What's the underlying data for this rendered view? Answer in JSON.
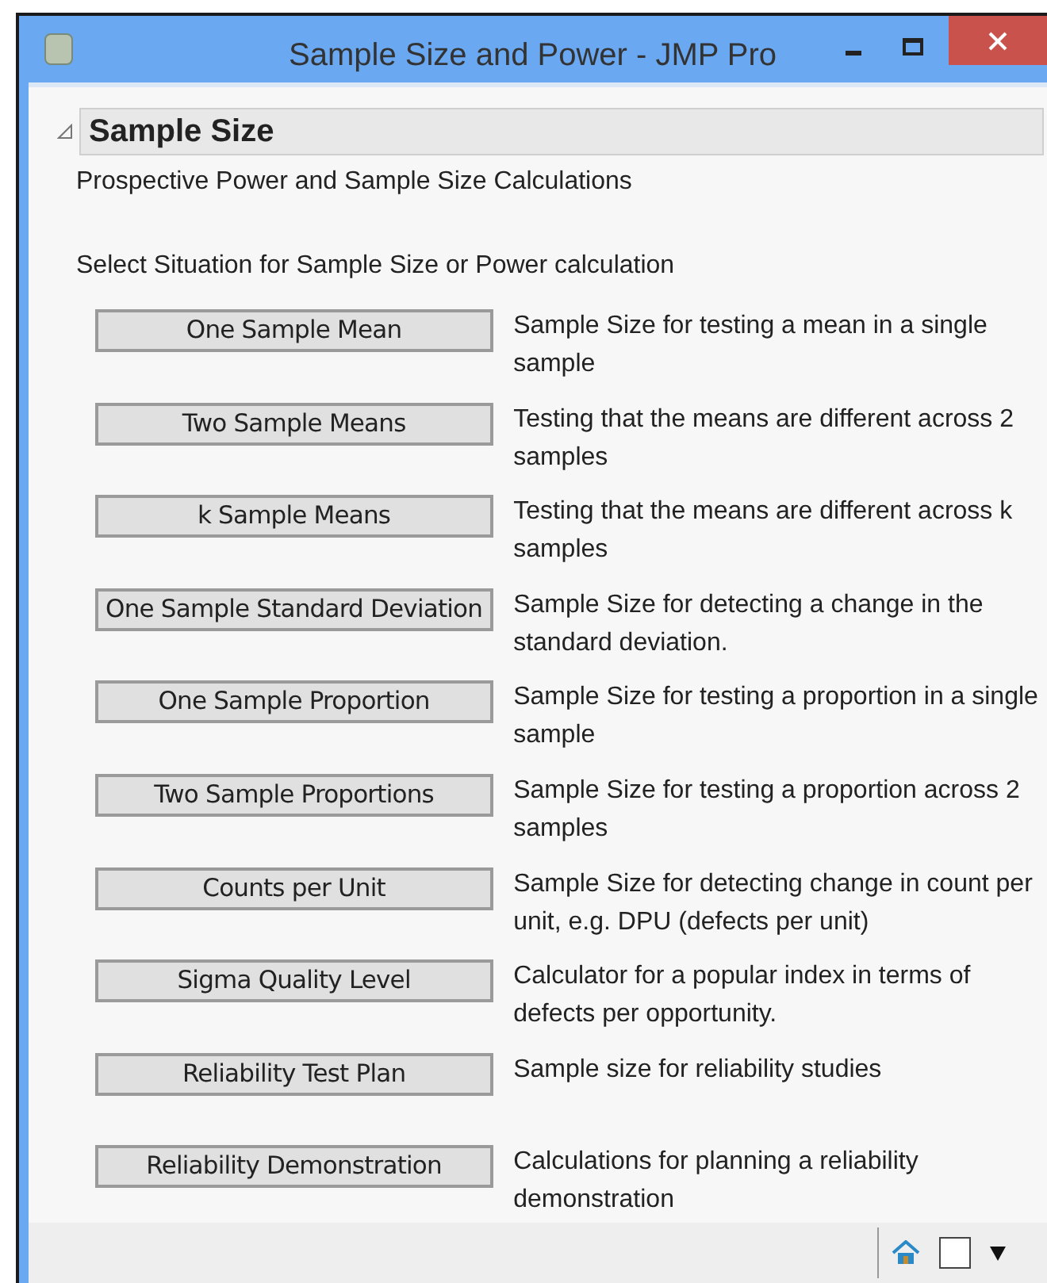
{
  "window": {
    "title": "Sample Size and Power - JMP Pro"
  },
  "section": {
    "title": "Sample Size",
    "expanded": true,
    "subtitle": "Prospective Power and Sample Size Calculations",
    "prompt": "Select Situation for Sample Size or Power calculation"
  },
  "situations": [
    {
      "button": "One Sample Mean",
      "description": "Sample Size for testing a mean in a single sample"
    },
    {
      "button": "Two Sample Means",
      "description": "Testing that the means are different across 2 samples"
    },
    {
      "button": "k Sample Means",
      "description": "Testing that the means are different across k samples"
    },
    {
      "button": "One Sample Standard Deviation",
      "description": "Sample Size for detecting a change in the standard deviation."
    },
    {
      "button": "One Sample Proportion",
      "description": "Sample Size for testing a proportion in a single sample"
    },
    {
      "button": "Two Sample Proportions",
      "description": "Sample Size for testing a proportion across 2 samples"
    },
    {
      "button": "Counts per Unit",
      "description": "Sample Size for detecting change in count per unit, e.g. DPU (defects per unit)"
    },
    {
      "button": "Sigma Quality Level",
      "description": "Calculator for a popular index in terms of defects per opportunity."
    },
    {
      "button": "Reliability Test Plan",
      "description": "Sample size for reliability studies"
    },
    {
      "button": "Reliability Demonstration",
      "description": "Calculations for planning a reliability demonstration"
    }
  ]
}
